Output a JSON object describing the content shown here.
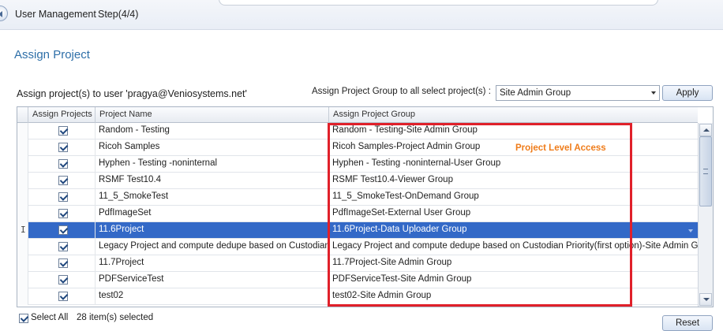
{
  "header": {
    "title": "User Management",
    "step": "Step(4/4)"
  },
  "section_title": "Assign Project",
  "assign_label": "Assign project(s) to user 'pragya@Veniosystems.net'",
  "group_selector": {
    "label": "Assign Project Group to all select project(s) :",
    "selected": "Site Admin Group",
    "apply_label": "Apply"
  },
  "grid": {
    "columns": [
      "Assign Projects",
      "Project Name",
      "Assign Project Group"
    ],
    "rows": [
      {
        "checked": true,
        "name": "Random - Testing",
        "group": "Random - Testing-Site Admin Group",
        "selected": false
      },
      {
        "checked": true,
        "name": "Ricoh Samples",
        "group": "Ricoh Samples-Project Admin Group",
        "selected": false
      },
      {
        "checked": true,
        "name": "Hyphen - Testing -noninternal",
        "group": "Hyphen - Testing -noninternal-User Group",
        "selected": false
      },
      {
        "checked": true,
        "name": "RSMF Test10.4",
        "group": "RSMF Test10.4-Viewer Group",
        "selected": false
      },
      {
        "checked": true,
        "name": "11_5_SmokeTest",
        "group": "11_5_SmokeTest-OnDemand Group",
        "selected": false
      },
      {
        "checked": true,
        "name": "PdfImageSet",
        "group": "PdfImageSet-External User Group",
        "selected": false
      },
      {
        "checked": true,
        "name": "11.6Project",
        "group": "11.6Project-Data Uploader Group",
        "selected": true
      },
      {
        "checked": true,
        "name": "Legacy Project and compute dedupe based on Custodian ...",
        "group": "Legacy Project and compute dedupe based on Custodian Priority(first option)-Site Admin Group",
        "selected": false
      },
      {
        "checked": true,
        "name": "11.7Project",
        "group": "11.7Project-Site Admin Group",
        "selected": false
      },
      {
        "checked": true,
        "name": "PDFServiceTest",
        "group": "PDFServiceTest-Site Admin Group",
        "selected": false
      },
      {
        "checked": true,
        "name": "test02",
        "group": "test02-Site Admin Group",
        "selected": false
      }
    ],
    "row_indicator": "I"
  },
  "annotation": {
    "text": "Project Level Access",
    "color": "#e0202a",
    "text_color": "#ef7c1a"
  },
  "footer": {
    "select_all_label": "Select All",
    "select_all_checked": true,
    "count_label": "28 item(s) selected",
    "reset_label": "Reset"
  },
  "colors": {
    "accent": "#2e6fa8",
    "selection": "#3369c7"
  }
}
